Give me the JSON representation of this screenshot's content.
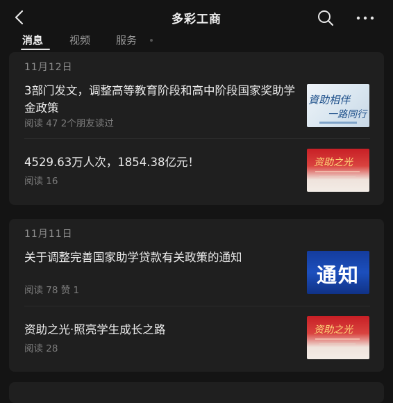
{
  "header": {
    "title": "多彩工商"
  },
  "tabs": [
    {
      "label": "消息"
    },
    {
      "label": "视频"
    },
    {
      "label": "服务"
    }
  ],
  "feed": [
    {
      "date": "11月12日",
      "articles": [
        {
          "title": "3部门发文，调整高等教育阶段和高中阶段国家奖助学金政策",
          "meta": "阅读 47   2个朋友读过",
          "thumb_text": [
            "資助相伴",
            "一路同行"
          ]
        },
        {
          "title": "4529.63万人次，1854.38亿元！",
          "meta": "阅读 16",
          "thumb_text": [
            "资助之光"
          ]
        }
      ]
    },
    {
      "date": "11月11日",
      "articles": [
        {
          "title": "关于调整完善国家助学贷款有关政策的通知",
          "meta": "阅读 78  赞 1",
          "thumb_text": [
            "通知"
          ]
        },
        {
          "title": "资助之光·照亮学生成长之路",
          "meta": "阅读 28",
          "thumb_text": [
            "资助之光"
          ]
        }
      ]
    }
  ],
  "colors": {
    "background": "#141414",
    "card": "#1f1f1f",
    "accent_red": "#c81f25",
    "notice_blue": "#1c4fbd"
  }
}
